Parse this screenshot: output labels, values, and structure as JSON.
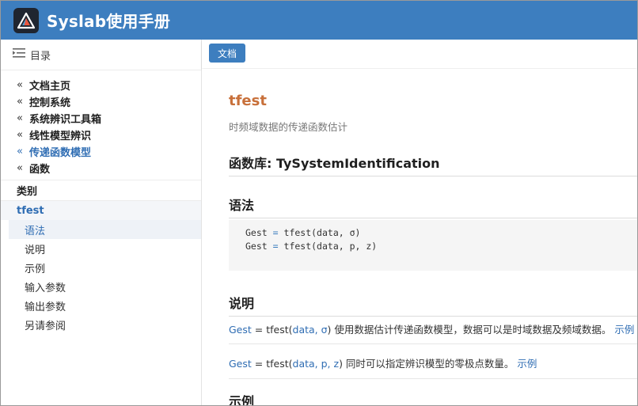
{
  "header": {
    "title": "Syslab使用手册"
  },
  "sidebar": {
    "toc_label": "目录",
    "nav": [
      {
        "label": "文档主页"
      },
      {
        "label": "控制系统"
      },
      {
        "label": "系统辨识工具箱"
      },
      {
        "label": "线性模型辨识"
      },
      {
        "label": "传递函数模型"
      },
      {
        "label": "函数"
      }
    ],
    "category_label": "类别",
    "page_label": "tfest",
    "subitems": [
      {
        "label": "语法"
      },
      {
        "label": "说明"
      },
      {
        "label": "示例"
      },
      {
        "label": "输入参数"
      },
      {
        "label": "输出参数"
      },
      {
        "label": "另请参阅"
      }
    ]
  },
  "toolbar": {
    "doc_button": "文档"
  },
  "main": {
    "title": "tfest",
    "subtitle": "时频域数据的传递函数估计",
    "library_heading": "函数库: TySystemIdentification",
    "syntax_heading": "语法",
    "code": {
      "line1": {
        "lhs": "Gest",
        "op": "=",
        "rhs": "tfest(data, σ)"
      },
      "line2": {
        "lhs": "Gest",
        "op": "=",
        "rhs": "tfest(data, p, z)"
      }
    },
    "desc_heading": "说明",
    "desc1": {
      "var": "Gest",
      "eq": " = ",
      "fn": "tfest(",
      "args": "data, σ",
      "close": ")",
      "text": " 使用数据估计传递函数模型，数据可以是时域数据及频域数据。",
      "link": "示例"
    },
    "desc2": {
      "var": "Gest",
      "eq": " = ",
      "fn": "tfest(",
      "args": "data, p, z",
      "close": ")",
      "text": " 同时可以指定辨识模型的零极点数量。",
      "link": "示例"
    },
    "examples_heading": "示例"
  },
  "colors": {
    "header": "#3d7ebf",
    "accent_title": "#c8703a",
    "link": "#2f6db3"
  },
  "icons": {
    "logo": "syslab-logo-icon",
    "toc": "list-indent-icon",
    "chevron": "double-chevron-left-icon"
  }
}
